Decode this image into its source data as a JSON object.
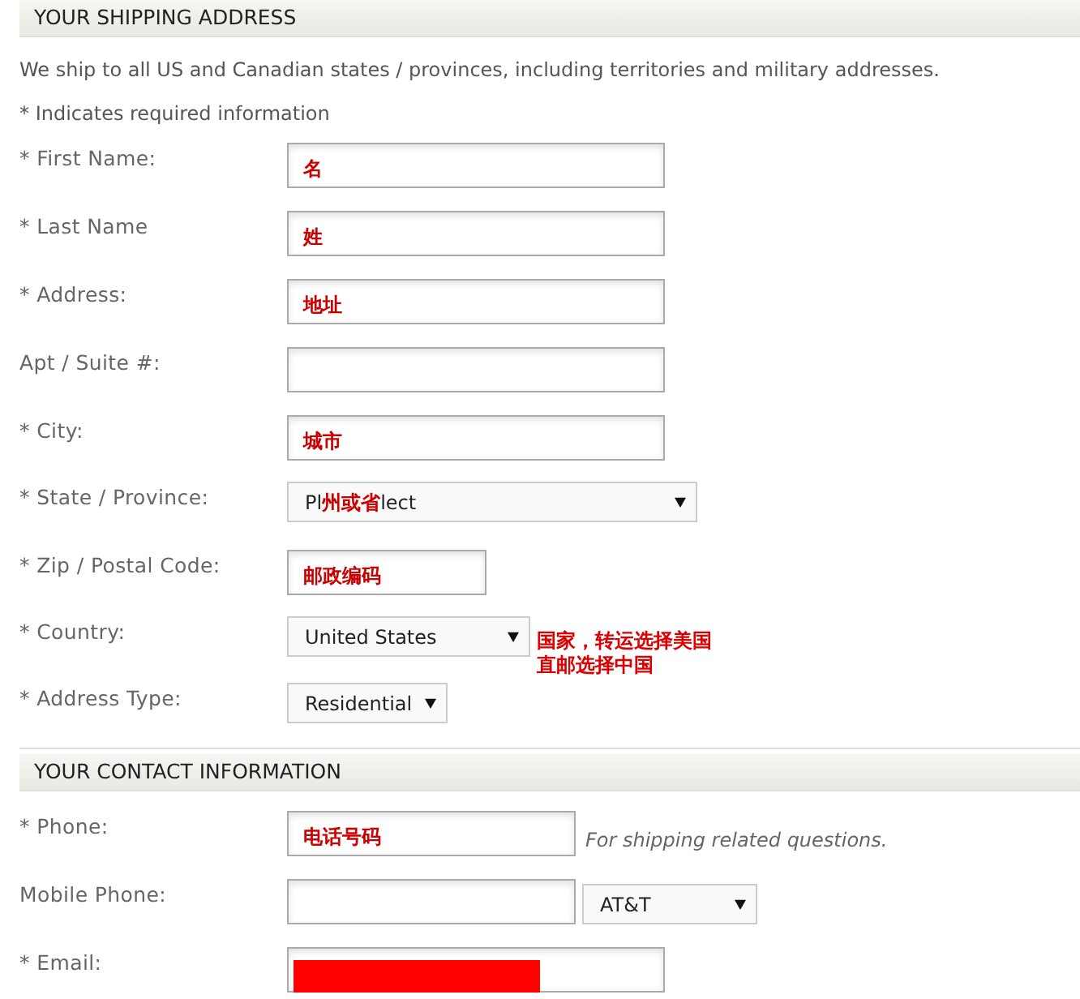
{
  "sections": [
    {
      "title": "YOUR SHIPPING ADDRESS",
      "intro": "We ship to all US and Canadian states / provinces, including territories and military addresses.",
      "required_note": "* Indicates required information",
      "fields": [
        {
          "kind": "text",
          "label": "* First Name:",
          "annotation": "名"
        },
        {
          "kind": "text",
          "label": "* Last Name",
          "annotation": "姓"
        },
        {
          "kind": "text",
          "label": "* Address:",
          "annotation": "地址"
        },
        {
          "kind": "text",
          "label": "Apt / Suite #:"
        },
        {
          "kind": "text",
          "label": "* City:",
          "annotation": "城市"
        },
        {
          "kind": "select",
          "label": "* State / Province:",
          "value_start": "Pl",
          "annotation": "州或省",
          "value_end": "lect"
        },
        {
          "kind": "text",
          "label": "* Zip / Postal Code:",
          "annotation": "邮政编码"
        },
        {
          "kind": "select",
          "label": "* Country:",
          "value": "United States",
          "side_note": [
            "国家，转运选择美国",
            "直邮选择中国"
          ]
        },
        {
          "kind": "select",
          "label": "* Address Type:",
          "value": "Residential"
        }
      ]
    },
    {
      "title": "YOUR CONTACT INFORMATION",
      "fields": [
        {
          "kind": "text",
          "label": "* Phone:",
          "annotation": "电话号码",
          "hint": "For shipping related questions."
        },
        {
          "kind": "text",
          "label": "Mobile Phone:",
          "carrier": "AT&T"
        },
        {
          "kind": "text",
          "label": "* Email:",
          "redacted": true
        }
      ]
    }
  ]
}
